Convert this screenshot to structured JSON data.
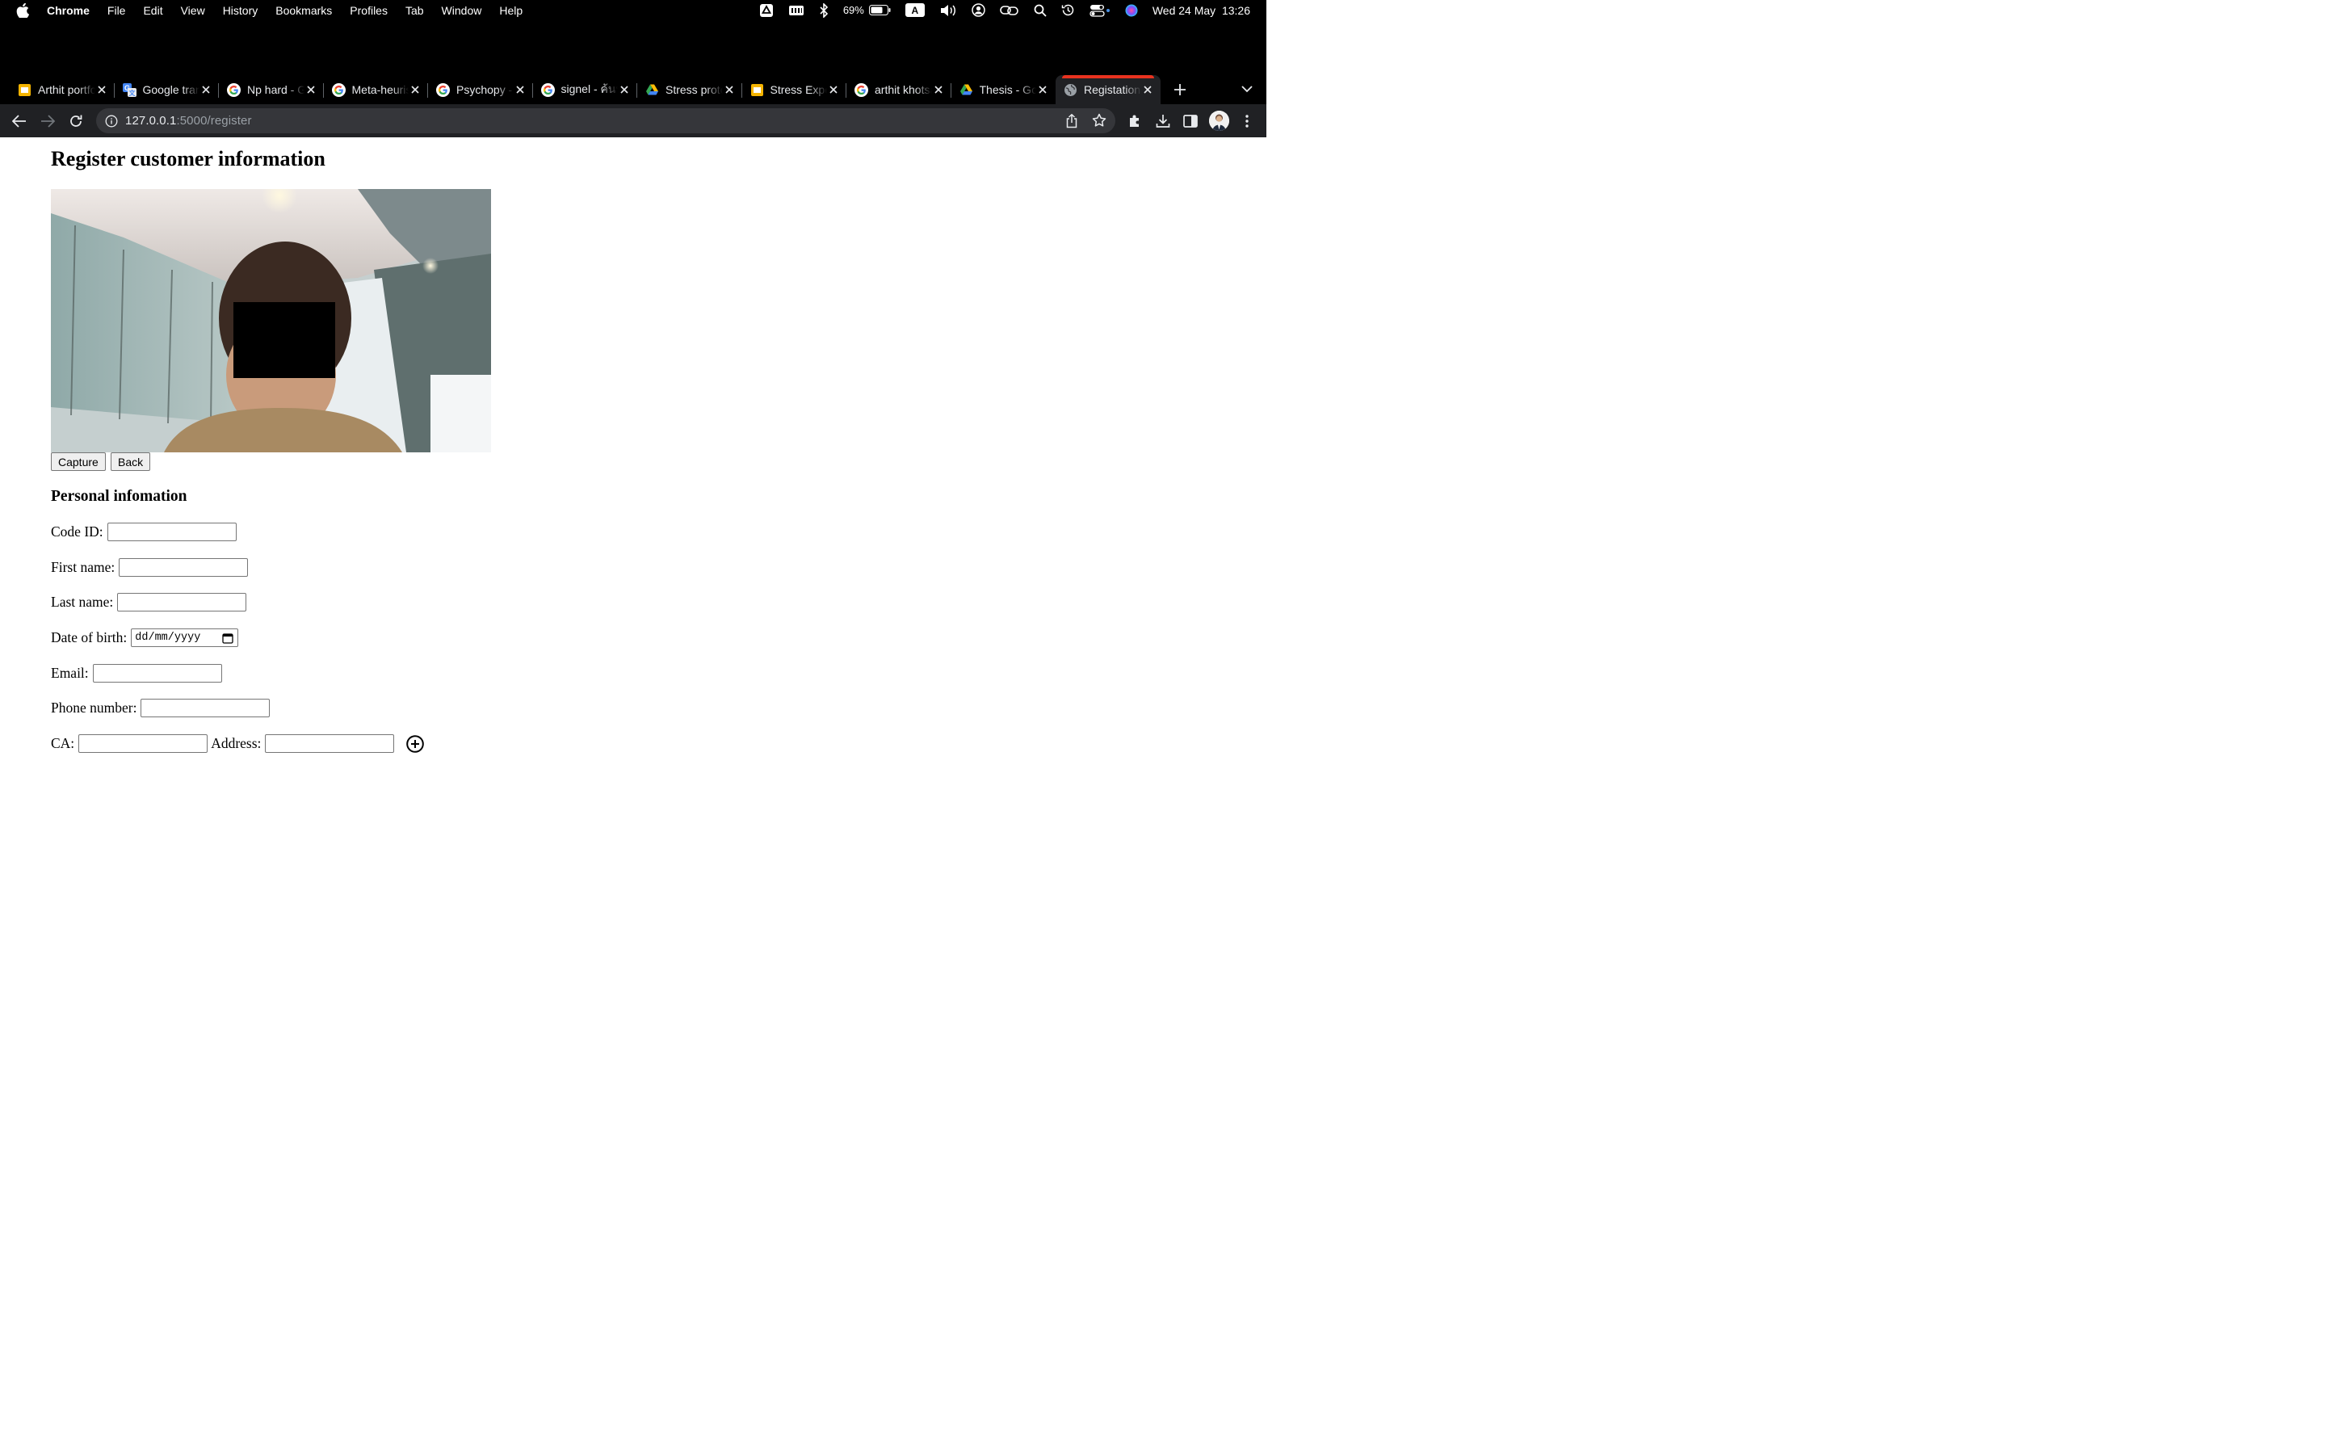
{
  "menubar": {
    "app_name": "Chrome",
    "items": [
      "File",
      "Edit",
      "View",
      "History",
      "Bookmarks",
      "Profiles",
      "Tab",
      "Window",
      "Help"
    ],
    "battery_percent": "69%",
    "input_source": "A",
    "datetime": "Wed 24 May  13:26"
  },
  "tabs": [
    {
      "title": "Arthit portfolio",
      "icon": "slides-icon",
      "color": "#f4b400"
    },
    {
      "title": "Google translate",
      "icon": "translate-icon",
      "color": "#4285f4"
    },
    {
      "title": "Np hard - Google Search",
      "icon": "google-icon",
      "color": "#ffffff"
    },
    {
      "title": "Meta-heuristic - Google Search",
      "icon": "google-icon",
      "color": "#ffffff"
    },
    {
      "title": "Psychopy - Google Search",
      "icon": "google-icon",
      "color": "#ffffff"
    },
    {
      "title": "signel - ค้นหาด้วย Google",
      "icon": "google-icon",
      "color": "#ffffff"
    },
    {
      "title": "Stress protocol",
      "icon": "drive-icon",
      "color": "#34a853"
    },
    {
      "title": "Stress Experiment",
      "icon": "slides-icon",
      "color": "#f4b400"
    },
    {
      "title": "arthit khotsaenlang - Google Search",
      "icon": "google-icon",
      "color": "#ffffff"
    },
    {
      "title": "Thesis - Google Drive",
      "icon": "drive-icon",
      "color": "#34a853"
    },
    {
      "title": "Registation",
      "icon": "globe-icon",
      "color": "#9aa0a6",
      "active": true
    }
  ],
  "address_bar": {
    "host": "127.0.0.1",
    "path": ":5000/register"
  },
  "page": {
    "title": "Register customer information",
    "capture_label": "Capture",
    "back_label": "Back",
    "section_title": "Personal infomation",
    "fields": {
      "code_id": "Code ID:",
      "first_name": "First name:",
      "last_name": "Last name:",
      "dob": "Date of birth:",
      "email": "Email:",
      "phone": "Phone number:",
      "ca": "CA:",
      "address": "Address:"
    },
    "dob_placeholder": "dd/mm/yyyy"
  }
}
